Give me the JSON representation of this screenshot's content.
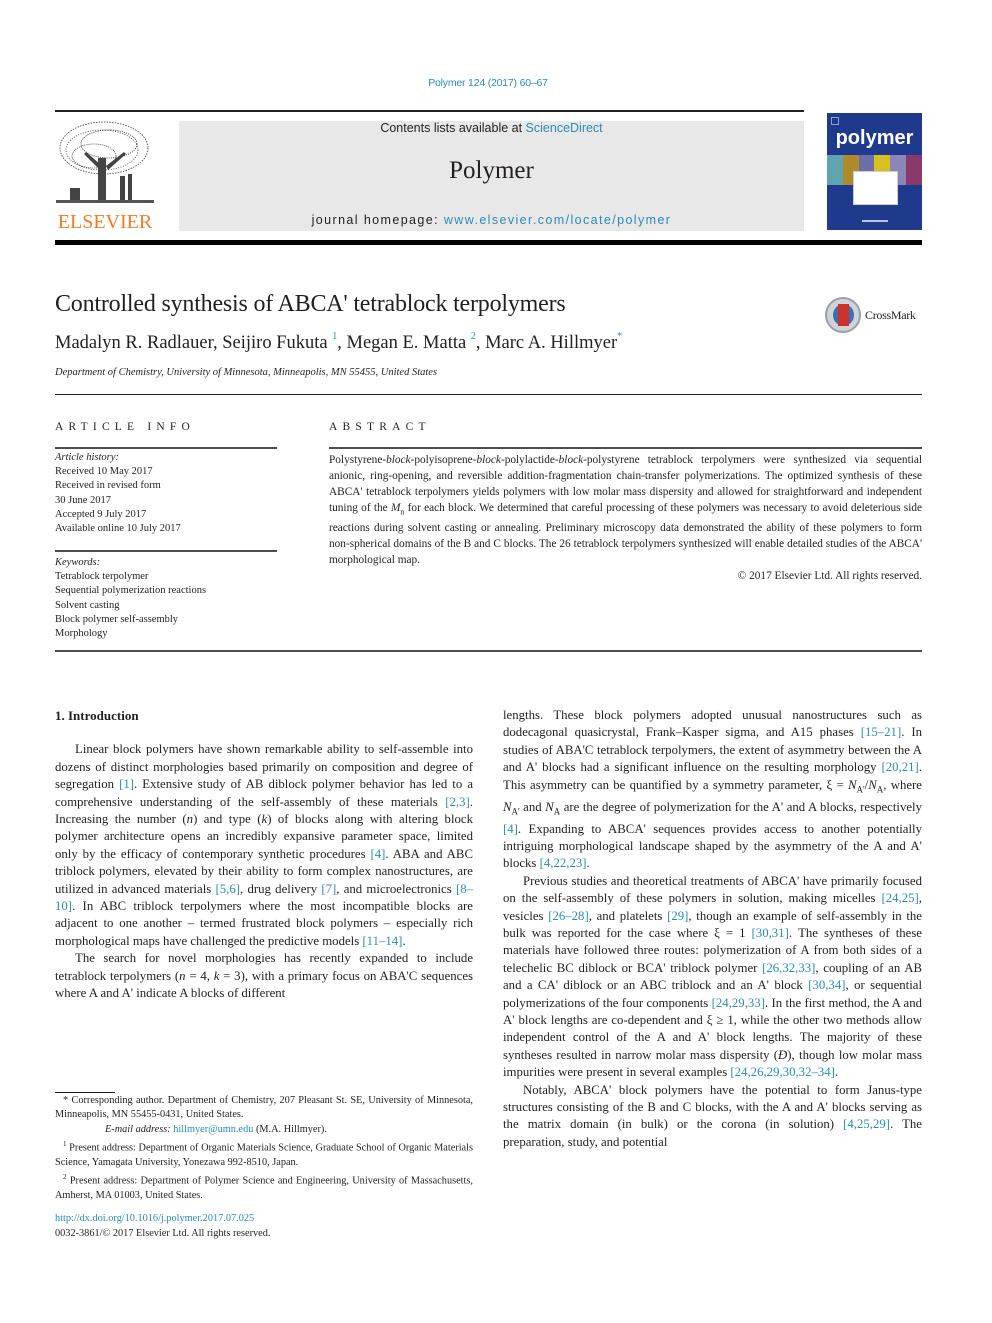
{
  "journal_ref": "Polymer 124 (2017) 60–67",
  "masthead": {
    "publisher_word": "ELSEVIER",
    "contents_prefix": "Contents lists available at ",
    "contents_link": "ScienceDirect",
    "journal_name": "Polymer",
    "homepage_prefix": "journal homepage: ",
    "homepage_link": "www.elsevier.com/locate/polymer",
    "cover_title": "polymer"
  },
  "colors": {
    "link": "#2a8cbc",
    "elsevier_orange": "#f47b20",
    "masthead_gray": "#e8e8e8",
    "cover_blue": "#1f3a8c",
    "crossmark_red": "#c9332c"
  },
  "article": {
    "title": "Controlled synthesis of ABCA' tetrablock terpolymers",
    "crossmark_label": "CrossMark",
    "authors": [
      {
        "name": "Madalyn R. Radlauer",
        "mark": ""
      },
      {
        "name": "Seijiro Fukuta",
        "mark": "1"
      },
      {
        "name": "Megan E. Matta",
        "mark": "2"
      },
      {
        "name": "Marc A. Hillmyer",
        "mark": "*"
      }
    ],
    "affiliation": "Department of Chemistry, University of Minnesota, Minneapolis, MN 55455, United States"
  },
  "article_info": {
    "heading": "ARTICLE INFO",
    "history_label": "Article history:",
    "history": [
      "Received 10 May 2017",
      "Received in revised form",
      "30 June 2017",
      "Accepted 9 July 2017",
      "Available online 10 July 2017"
    ],
    "keywords_label": "Keywords:",
    "keywords": [
      "Tetrablock terpolymer",
      "Sequential polymerization reactions",
      "Solvent casting",
      "Block polymer self-assembly",
      "Morphology"
    ]
  },
  "abstract": {
    "heading": "ABSTRACT",
    "segments": [
      {
        "t": "Polystyrene-",
        "i": false
      },
      {
        "t": "block",
        "i": true
      },
      {
        "t": "-polyisoprene-",
        "i": false
      },
      {
        "t": "block",
        "i": true
      },
      {
        "t": "-polylactide-",
        "i": false
      },
      {
        "t": "block",
        "i": true
      },
      {
        "t": "-polystyrene tetrablock terpolymers were synthesized via sequential anionic, ring-opening, and reversible addition-fragmentation chain-transfer polymerizations. The optimized synthesis of these ABCA' tetrablock terpolymers yields polymers with low molar mass dispersity and allowed for straightforward and independent tuning of the ",
        "i": false
      },
      {
        "t": "M",
        "i": true
      },
      {
        "t": "n",
        "sub": true
      },
      {
        "t": " for each block. We determined that careful processing of these polymers was necessary to avoid deleterious side reactions during solvent casting or annealing. Preliminary microscopy data demonstrated the ability of these polymers to form non-spherical domains of the B and C blocks. The 26 tetrablock terpolymers synthesized will enable detailed studies of the ABCA' morphological map.",
        "i": false
      }
    ],
    "copyright": "© 2017 Elsevier Ltd. All rights reserved."
  },
  "body": {
    "section_heading": "1.  Introduction",
    "left_paragraphs": [
      [
        {
          "t": "Linear block polymers have shown remarkable ability to self-assemble into dozens of distinct morphologies based primarily on composition and degree of segregation "
        },
        {
          "t": "[1]",
          "link": true
        },
        {
          "t": ". Extensive study of AB diblock polymer behavior has led to a comprehensive understanding of the self-assembly of these materials "
        },
        {
          "t": "[2,3]",
          "link": true
        },
        {
          "t": ". Increasing the number ("
        },
        {
          "t": "n",
          "i": true
        },
        {
          "t": ") and type ("
        },
        {
          "t": "k",
          "i": true
        },
        {
          "t": ") of blocks along with altering block polymer architecture opens an incredibly expansive parameter space, limited only by the efficacy of contemporary synthetic procedures "
        },
        {
          "t": "[4]",
          "link": true
        },
        {
          "t": ". ABA and ABC triblock polymers, elevated by their ability to form complex nanostructures, are utilized in advanced materials "
        },
        {
          "t": "[5,6]",
          "link": true
        },
        {
          "t": ", drug delivery "
        },
        {
          "t": "[7]",
          "link": true
        },
        {
          "t": ", and microelectronics "
        },
        {
          "t": "[8–10]",
          "link": true
        },
        {
          "t": ". In ABC triblock terpolymers where the most incompatible blocks are adjacent to one another – termed frustrated block polymers – especially rich morphological maps have challenged the predictive models "
        },
        {
          "t": "[11–14]",
          "link": true
        },
        {
          "t": "."
        }
      ],
      [
        {
          "t": "The search for novel morphologies has recently expanded to include tetrablock terpolymers ("
        },
        {
          "t": "n",
          "i": true
        },
        {
          "t": " = 4, "
        },
        {
          "t": "k",
          "i": true
        },
        {
          "t": " = 3), with a primary focus on ABA'C sequences where A and A' indicate A blocks of different"
        }
      ]
    ],
    "right_paragraphs": [
      [
        {
          "t": "lengths. These block polymers adopted unusual nanostructures such as dodecagonal quasicrystal, Frank–Kasper sigma, and A15 phases "
        },
        {
          "t": "[15–21]",
          "link": true
        },
        {
          "t": ". In studies of ABA'C tetrablock terpolymers, the extent of asymmetry between the A and A' blocks had a significant influence on the resulting morphology "
        },
        {
          "t": "[20,21]",
          "link": true
        },
        {
          "t": ". This asymmetry can be quantified by a symmetry parameter, ξ = "
        },
        {
          "t": "N",
          "i": true
        },
        {
          "t": "A'",
          "sub": true
        },
        {
          "t": "/"
        },
        {
          "t": "N",
          "i": true
        },
        {
          "t": "A",
          "sub": true
        },
        {
          "t": ", where "
        },
        {
          "t": "N",
          "i": true
        },
        {
          "t": "A'",
          "sub": true
        },
        {
          "t": " and "
        },
        {
          "t": "N",
          "i": true
        },
        {
          "t": "A",
          "sub": true
        },
        {
          "t": " are the degree of polymerization for the A' and A blocks, respectively "
        },
        {
          "t": "[4]",
          "link": true
        },
        {
          "t": ". Expanding to ABCA' sequences provides access to another potentially intriguing morphological landscape shaped by the asymmetry of the A and A' blocks "
        },
        {
          "t": "[4,22,23]",
          "link": true
        },
        {
          "t": "."
        }
      ],
      [
        {
          "t": "Previous studies and theoretical treatments of ABCA' have primarily focused on the self-assembly of these polymers in solution, making micelles "
        },
        {
          "t": "[24,25]",
          "link": true
        },
        {
          "t": ", vesicles "
        },
        {
          "t": "[26–28]",
          "link": true
        },
        {
          "t": ", and platelets "
        },
        {
          "t": "[29]",
          "link": true
        },
        {
          "t": ", though an example of self-assembly in the bulk was reported for the case where ξ = 1 "
        },
        {
          "t": "[30,31]",
          "link": true
        },
        {
          "t": ". The syntheses of these materials have followed three routes: polymerization of A from both sides of a telechelic BC diblock or BCA' triblock polymer "
        },
        {
          "t": "[26,32,33]",
          "link": true
        },
        {
          "t": ", coupling of an AB and a CA' diblock or an ABC triblock and an A' block "
        },
        {
          "t": "[30,34]",
          "link": true
        },
        {
          "t": ", or sequential polymerizations of the four components "
        },
        {
          "t": "[24,29,33]",
          "link": true
        },
        {
          "t": ". In the first method, the A and A' block lengths are co-dependent and ξ ≥ 1, while the other two methods allow independent control of the A and A' block lengths. The majority of these syntheses resulted in narrow molar mass dispersity ("
        },
        {
          "t": "Đ",
          "i": true
        },
        {
          "t": "), though low molar mass impurities were present in several examples "
        },
        {
          "t": "[24,26,29,30,32–34]",
          "link": true
        },
        {
          "t": "."
        }
      ],
      [
        {
          "t": "Notably, ABCA' block polymers have the potential to form Janus-type structures consisting of the B and C blocks, with the A and A' blocks serving as the matrix domain (in bulk) or the corona (in solution) "
        },
        {
          "t": "[4,25,29]",
          "link": true
        },
        {
          "t": ". The preparation, study, and potential"
        }
      ]
    ]
  },
  "footnotes": {
    "corresponding": "* Corresponding author. Department of Chemistry, 207 Pleasant St. SE, University of Minnesota, Minneapolis, MN 55455-0431, United States.",
    "email_label": "E-mail address: ",
    "email": "hillmyer@umn.edu",
    "email_suffix": " (M.A. Hillmyer).",
    "note1_mark": "1",
    "note1": " Present address: Department of Organic Materials Science, Graduate School of Organic Materials Science, Yamagata University, Yonezawa 992-8510, Japan.",
    "note2_mark": "2",
    "note2": " Present address: Department of Polymer Science and Engineering, University of Massachusetts, Amherst, MA 01003, United States."
  },
  "doi": "http://dx.doi.org/10.1016/j.polymer.2017.07.025",
  "issn_line": "0032-3861/© 2017 Elsevier Ltd. All rights reserved."
}
